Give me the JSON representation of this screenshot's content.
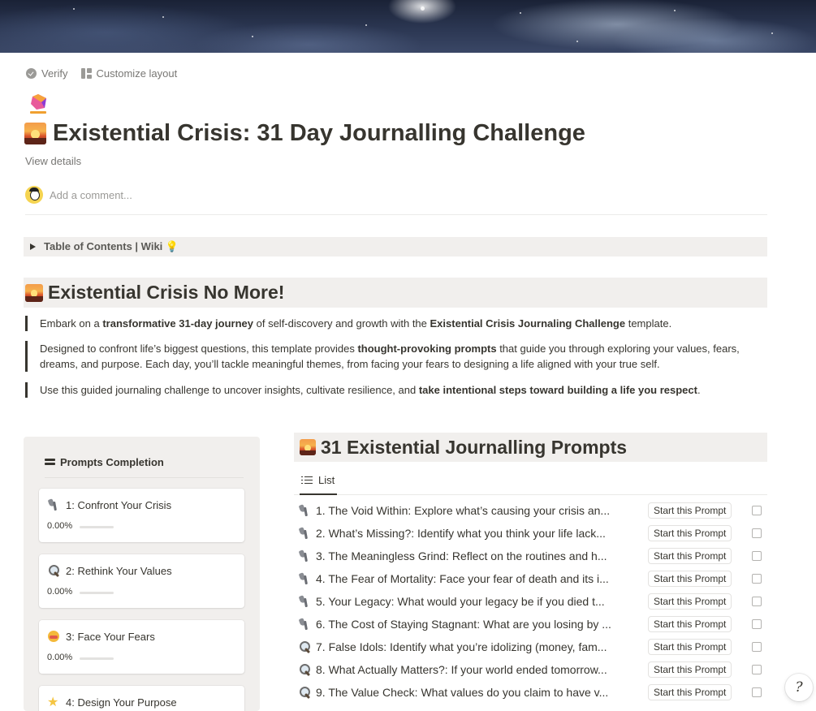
{
  "topbar": {
    "verify": "Verify",
    "customize": "Customize layout"
  },
  "page": {
    "title": "Existential Crisis: 31 Day Journalling Challenge",
    "view_details": "View details",
    "comment_placeholder": "Add a comment..."
  },
  "toc": {
    "label": "Table of Contents | Wiki 💡"
  },
  "intro": {
    "heading": "Existential Crisis No More!",
    "p1": {
      "a": "Embark on a ",
      "b": "transformative 31-day journey",
      "c": " of self-discovery and growth with the ",
      "d": "Existential Crisis Journaling Challenge",
      "e": " template."
    },
    "p2": {
      "a": "Designed to confront life’s biggest questions, this template provides ",
      "b": "thought-provoking prompts",
      "c": " that guide you through exploring your values, fears, dreams, and purpose. Each day, you’ll tackle meaningful themes, from facing your fears to designing a life aligned with your true self."
    },
    "p3": {
      "a": "Use this guided journaling challenge to uncover insights, cultivate resilience, and ",
      "b": "take intentional steps toward building a life you respect",
      "c": "."
    }
  },
  "completion": {
    "heading": "Prompts Completion",
    "cards": [
      {
        "icon": "anvil-icon",
        "label": "1: Confront Your Crisis",
        "percent": "0.00%",
        "progress": 0
      },
      {
        "icon": "magnifier-icon",
        "label": "2: Rethink Your Values",
        "percent": "0.00%",
        "progress": 0
      },
      {
        "icon": "face-icon",
        "label": "3: Face Your Fears",
        "percent": "0.00%",
        "progress": 0
      },
      {
        "icon": "star-icon",
        "label": "4: Design Your Purpose",
        "percent": "",
        "progress": 0
      }
    ]
  },
  "prompts": {
    "heading": "31 Existential Journalling Prompts",
    "view_tab": "List",
    "button_label": "Start this Prompt",
    "items": [
      {
        "icon": "anvil-icon",
        "title": "1. The Void Within: Explore what’s causing your crisis an..."
      },
      {
        "icon": "anvil-icon",
        "title": "2. What’s Missing?: Identify what you think your life lack..."
      },
      {
        "icon": "anvil-icon",
        "title": "3. The Meaningless Grind: Reflect on the routines and h..."
      },
      {
        "icon": "anvil-icon",
        "title": "4. The Fear of Mortality: Face your fear of death and its i..."
      },
      {
        "icon": "anvil-icon",
        "title": "5. Your Legacy: What would your legacy be if you died t..."
      },
      {
        "icon": "anvil-icon",
        "title": "6. The Cost of Staying Stagnant: What are you losing by ..."
      },
      {
        "icon": "magnifier-icon",
        "title": "7. False Idols: Identify what you’re idolizing (money, fam..."
      },
      {
        "icon": "magnifier-icon",
        "title": "8. What Actually Matters?: If your world ended tomorrow..."
      },
      {
        "icon": "magnifier-icon",
        "title": "9. The Value Check: What values do you claim to have v..."
      }
    ]
  },
  "colors": {
    "accent": "#2383e2",
    "block_bg": "#f1efed",
    "text": "#37352f"
  }
}
